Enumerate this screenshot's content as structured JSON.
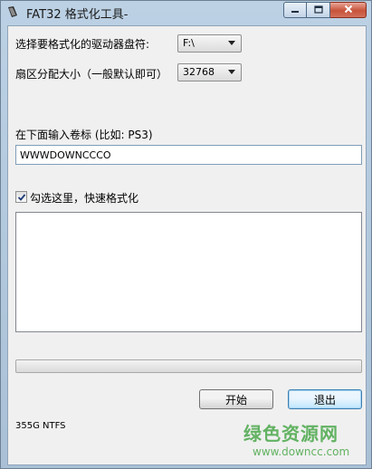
{
  "window": {
    "title": "FAT32 格式化工具-"
  },
  "form": {
    "drive_label": "选择要格式化的驱动器盘符:",
    "drive_value": "F:\\",
    "cluster_label": "扇区分配大小（一般默认即可）",
    "cluster_value": "32768",
    "volume_label": "在下面输入卷标 (比如: PS3)",
    "volume_value": "WWWDOWNCCCO",
    "quick_format_label": "勾选这里，快速格式化",
    "quick_format_checked": true
  },
  "progress": {
    "value": 0
  },
  "buttons": {
    "start_label": "开始",
    "exit_label": "退出"
  },
  "status": {
    "drive_info": "355G NTFS"
  },
  "watermark": {
    "site_name": "绿色资源网",
    "url": "www.downcc.com"
  },
  "colors": {
    "progress_fill": "#37b44a",
    "watermark": "#4aa84a",
    "close_button": "#c8523a"
  }
}
